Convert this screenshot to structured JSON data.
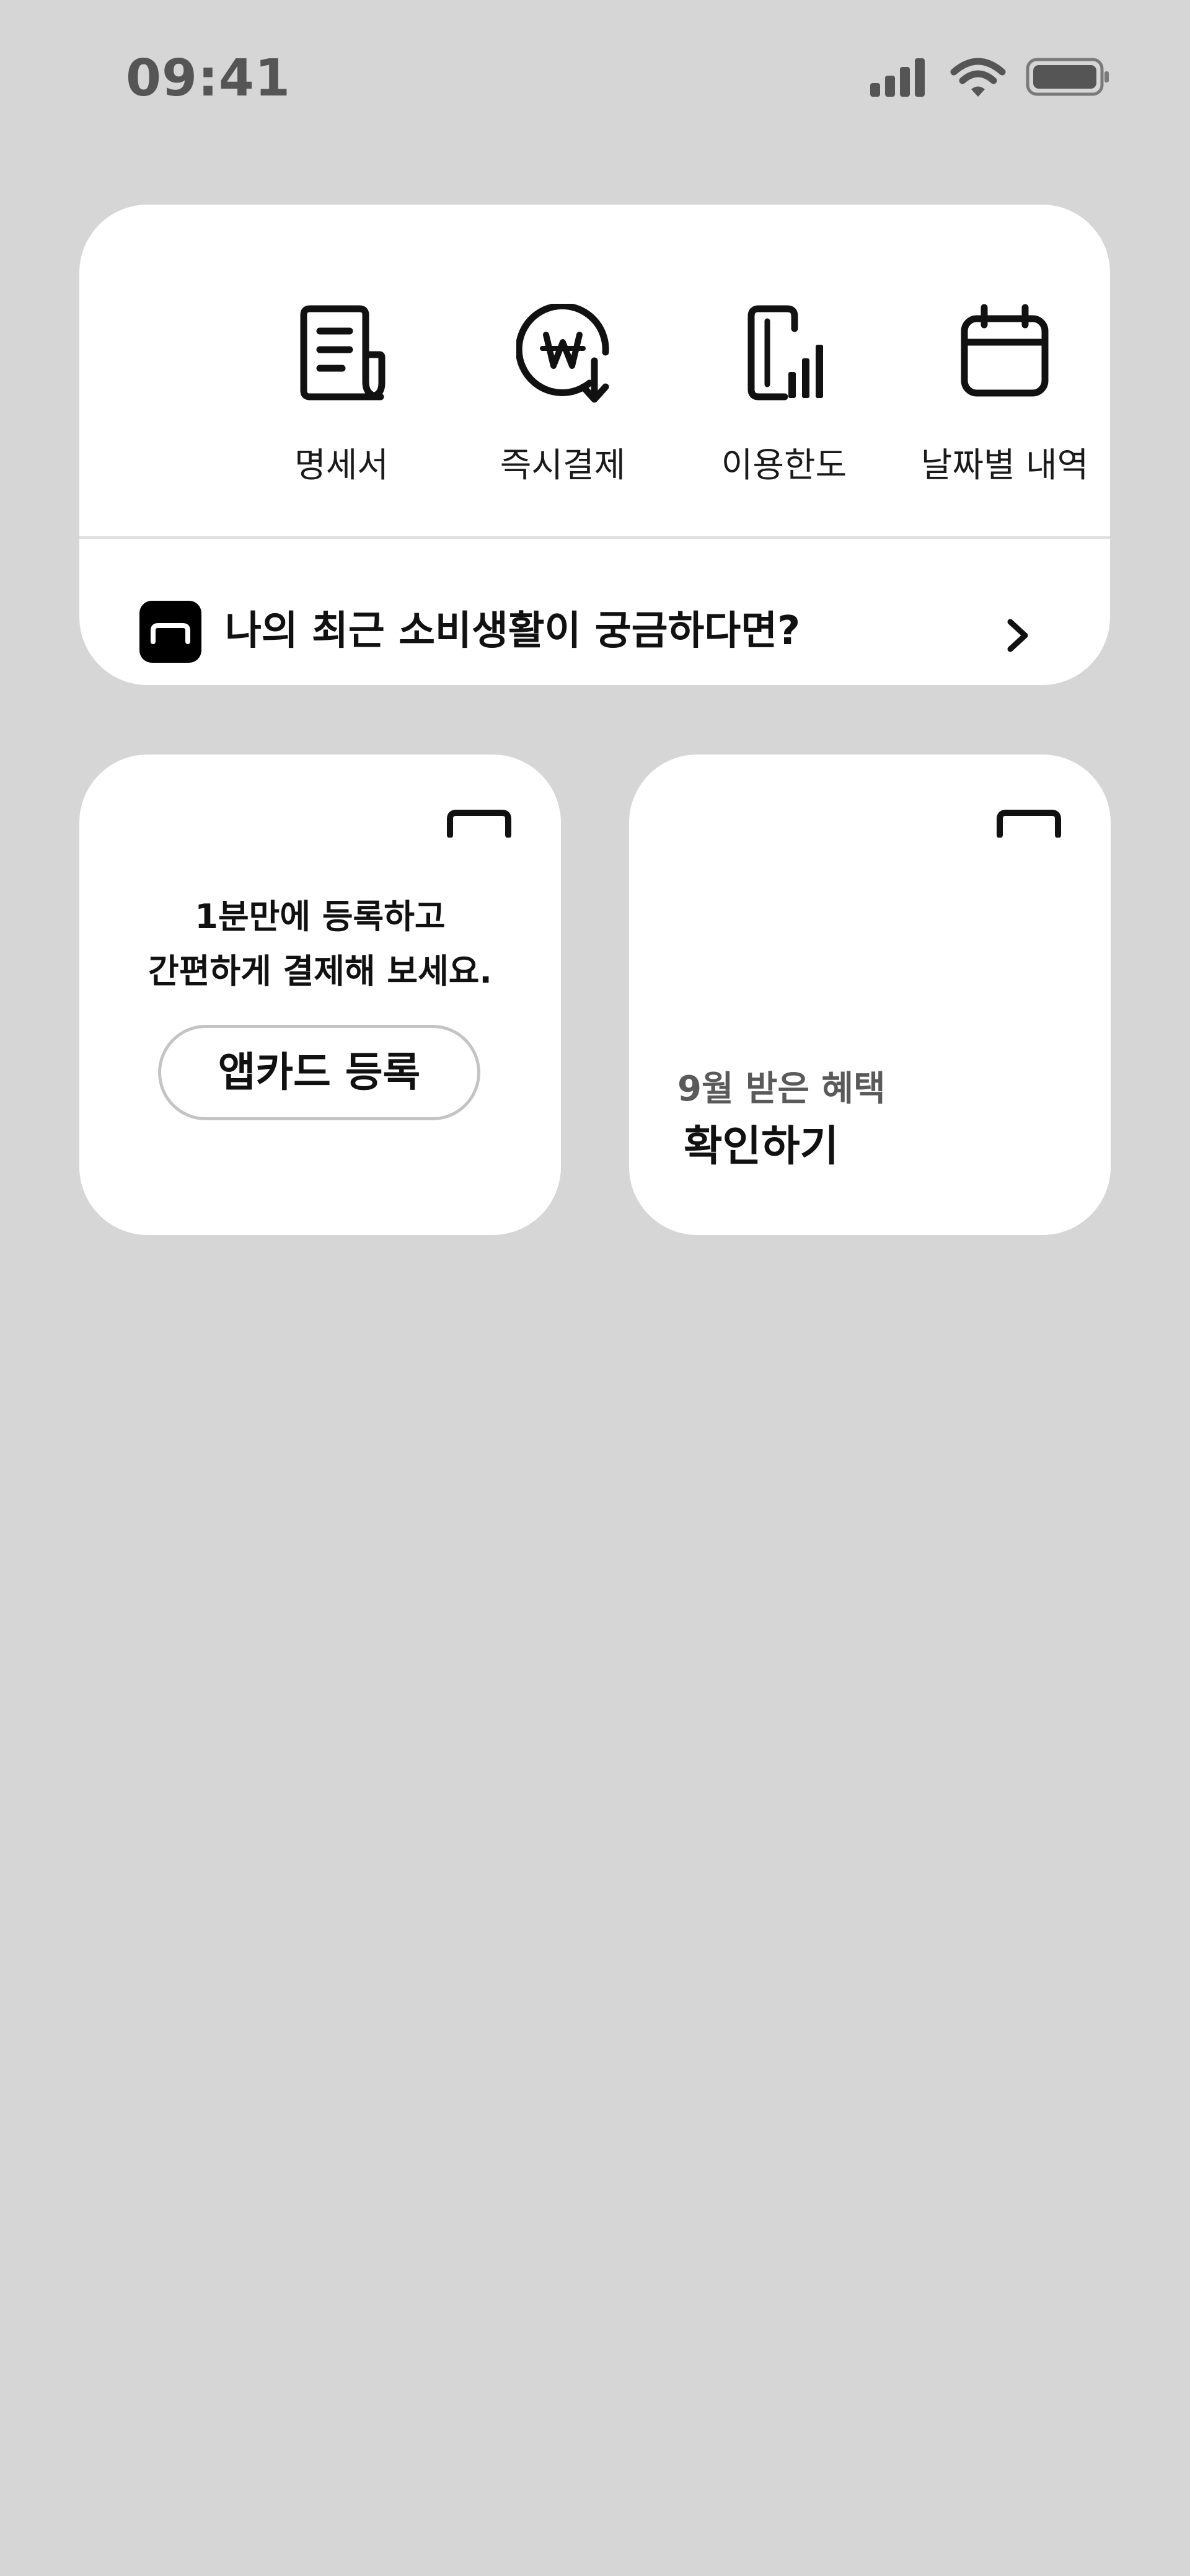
{
  "status_bar": {
    "time": "09:41",
    "icons": [
      "cellular-signal-icon",
      "wifi-icon",
      "battery-icon"
    ]
  },
  "quick_menu": {
    "items": [
      {
        "label": "명세서",
        "icon": "statement-document-icon"
      },
      {
        "label": "즉시결제",
        "icon": "won-instant-payment-icon"
      },
      {
        "label": "이용한도",
        "icon": "card-limit-chart-icon"
      },
      {
        "label": "날짜별 내역",
        "icon": "calendar-icon"
      }
    ],
    "banner": {
      "text": "나의 최근 소비생활이 궁금하다면?",
      "logo_icon": "card-logo-icon",
      "arrow_icon": "chevron-right-icon"
    }
  },
  "register_card": {
    "desc_line1": "1분만에 등록하고",
    "desc_line2": "간편하게 결제해 보세요.",
    "button_label": "앱카드 등록",
    "corner_icon": "card-bracket-icon"
  },
  "benefit_card": {
    "subtitle": "9월 받은 혜택",
    "title": "확인하기",
    "corner_icon": "card-bracket-icon"
  },
  "colors": {
    "background": "#d6d6d6",
    "card": "#ffffff",
    "text_primary": "#111111",
    "text_secondary": "#5a5a5a",
    "status_text": "#555555"
  }
}
